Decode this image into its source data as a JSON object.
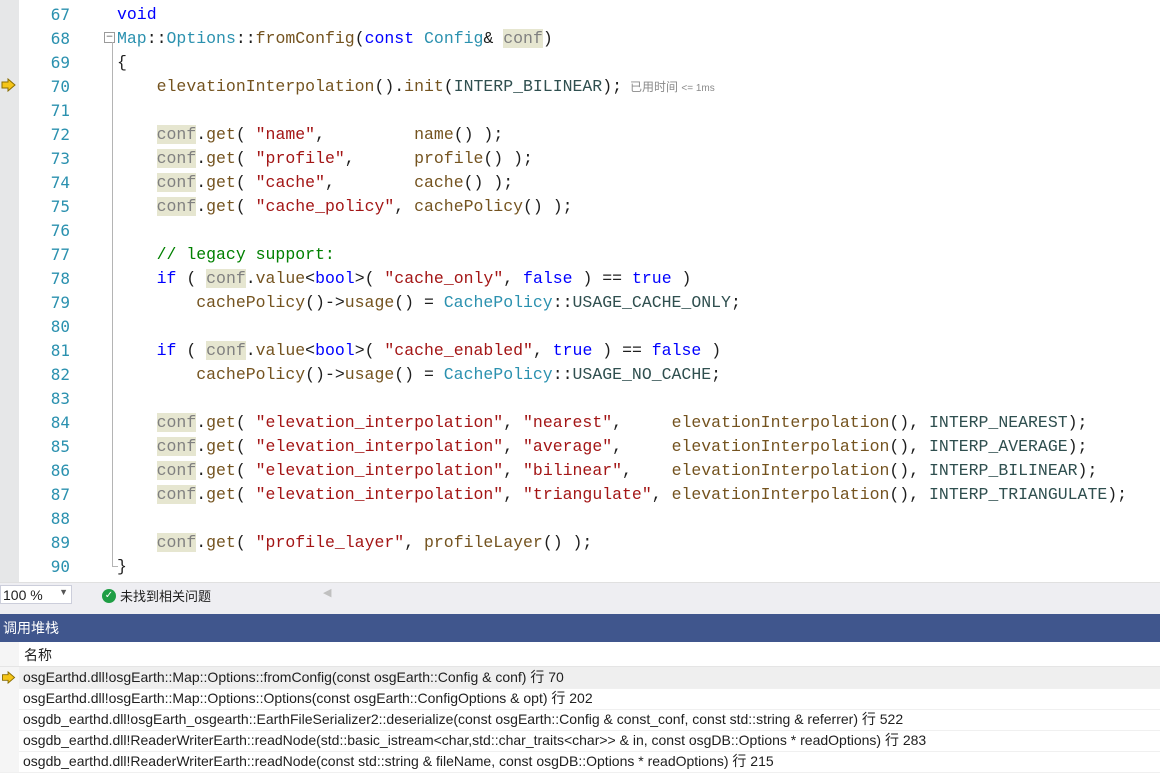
{
  "editor": {
    "lines": [
      {
        "num": "67",
        "html": "<span class=\"kw\">void</span>"
      },
      {
        "num": "68",
        "html": "<span class=\"tp\">Map</span>::<span class=\"tp\">Options</span>::<span class=\"fn\">fromConfig</span>(<span class=\"kw\">const</span> <span class=\"tp\">Config</span>&amp; <span class=\"pr\">conf</span>)"
      },
      {
        "num": "69",
        "html": "{"
      },
      {
        "num": "70",
        "html": "    <span class=\"fn\">elevationInterpolation</span>().<span class=\"fn\">init</span>(<span class=\"en\">INTERP_BILINEAR</span>);<span class=\"elapsed\">已用时间 <small>&lt;= 1ms</small></span>"
      },
      {
        "num": "71",
        "html": ""
      },
      {
        "num": "72",
        "html": "    <span class=\"pr\">conf</span>.<span class=\"fn\">get</span>( <span class=\"str\">\"name\"</span>,         <span class=\"fn\">name</span>() );"
      },
      {
        "num": "73",
        "html": "    <span class=\"pr\">conf</span>.<span class=\"fn\">get</span>( <span class=\"str\">\"profile\"</span>,      <span class=\"fn\">profile</span>() );"
      },
      {
        "num": "74",
        "html": "    <span class=\"pr\">conf</span>.<span class=\"fn\">get</span>( <span class=\"str\">\"cache\"</span>,        <span class=\"fn\">cache</span>() );"
      },
      {
        "num": "75",
        "html": "    <span class=\"pr\">conf</span>.<span class=\"fn\">get</span>( <span class=\"str\">\"cache_policy\"</span>, <span class=\"fn\">cachePolicy</span>() );"
      },
      {
        "num": "76",
        "html": ""
      },
      {
        "num": "77",
        "html": "    <span class=\"cm\">// legacy support:</span>"
      },
      {
        "num": "78",
        "html": "    <span class=\"kw\">if</span> ( <span class=\"pr\">conf</span>.<span class=\"fn\">value</span>&lt;<span class=\"kw\">bool</span>&gt;( <span class=\"str\">\"cache_only\"</span>, <span class=\"kw\">false</span> ) == <span class=\"kw\">true</span> )"
      },
      {
        "num": "79",
        "html": "        <span class=\"fn\">cachePolicy</span>()-&gt;<span class=\"fn\">usage</span>() = <span class=\"tp\">CachePolicy</span>::<span class=\"en\">USAGE_CACHE_ONLY</span>;"
      },
      {
        "num": "80",
        "html": ""
      },
      {
        "num": "81",
        "html": "    <span class=\"kw\">if</span> ( <span class=\"pr\">conf</span>.<span class=\"fn\">value</span>&lt;<span class=\"kw\">bool</span>&gt;( <span class=\"str\">\"cache_enabled\"</span>, <span class=\"kw\">true</span> ) == <span class=\"kw\">false</span> )"
      },
      {
        "num": "82",
        "html": "        <span class=\"fn\">cachePolicy</span>()-&gt;<span class=\"fn\">usage</span>() = <span class=\"tp\">CachePolicy</span>::<span class=\"en\">USAGE_NO_CACHE</span>;"
      },
      {
        "num": "83",
        "html": ""
      },
      {
        "num": "84",
        "html": "    <span class=\"pr\">conf</span>.<span class=\"fn\">get</span>( <span class=\"str\">\"elevation_interpolation\"</span>, <span class=\"str\">\"nearest\"</span>,     <span class=\"fn\">elevationInterpolation</span>(), <span class=\"en\">INTERP_NEAREST</span>);"
      },
      {
        "num": "85",
        "html": "    <span class=\"pr\">conf</span>.<span class=\"fn\">get</span>( <span class=\"str\">\"elevation_interpolation\"</span>, <span class=\"str\">\"average\"</span>,     <span class=\"fn\">elevationInterpolation</span>(), <span class=\"en\">INTERP_AVERAGE</span>);"
      },
      {
        "num": "86",
        "html": "    <span class=\"pr\">conf</span>.<span class=\"fn\">get</span>( <span class=\"str\">\"elevation_interpolation\"</span>, <span class=\"str\">\"bilinear\"</span>,    <span class=\"fn\">elevationInterpolation</span>(), <span class=\"en\">INTERP_BILINEAR</span>);"
      },
      {
        "num": "87",
        "html": "    <span class=\"pr\">conf</span>.<span class=\"fn\">get</span>( <span class=\"str\">\"elevation_interpolation\"</span>, <span class=\"str\">\"triangulate\"</span>, <span class=\"fn\">elevationInterpolation</span>(), <span class=\"en\">INTERP_TRIANGULATE</span>);"
      },
      {
        "num": "88",
        "html": ""
      },
      {
        "num": "89",
        "html": "    <span class=\"pr\">conf</span>.<span class=\"fn\">get</span>( <span class=\"str\">\"profile_layer\"</span>, <span class=\"fn\">profileLayer</span>() );"
      },
      {
        "num": "90",
        "html": "}"
      }
    ]
  },
  "statusbar": {
    "zoom": "100 %",
    "issues": "未找到相关问题"
  },
  "callstack": {
    "title": "调用堆栈",
    "column_name": "名称",
    "frames": [
      {
        "text": "osgEarthd.dll!osgEarth::Map::Options::fromConfig(const osgEarth::Config & conf) 行 70",
        "current": true
      },
      {
        "text": "osgEarthd.dll!osgEarth::Map::Options::Options(const osgEarth::ConfigOptions & opt) 行 202",
        "current": false
      },
      {
        "text": "osgdb_earthd.dll!osgEarth_osgearth::EarthFileSerializer2::deserialize(const osgEarth::Config & const_conf, const std::string & referrer) 行 522",
        "current": false
      },
      {
        "text": "osgdb_earthd.dll!ReaderWriterEarth::readNode(std::basic_istream<char,std::char_traits<char>> & in, const osgDB::Options * readOptions) 行 283",
        "current": false
      },
      {
        "text": "osgdb_earthd.dll!ReaderWriterEarth::readNode(const std::string & fileName, const osgDB::Options * readOptions) 行 215",
        "current": false
      }
    ]
  },
  "colors": {
    "panel_title_bg": "#40568d",
    "line_number": "#2b91af",
    "keyword": "#0000ff",
    "string": "#a31515",
    "comment": "#008000",
    "exec_arrow": "#f5c518"
  },
  "icons": {
    "exec_arrow": "current-statement-arrow-icon",
    "issues": "check-circle-icon",
    "zoom_dropdown": "chevron-down-icon"
  }
}
